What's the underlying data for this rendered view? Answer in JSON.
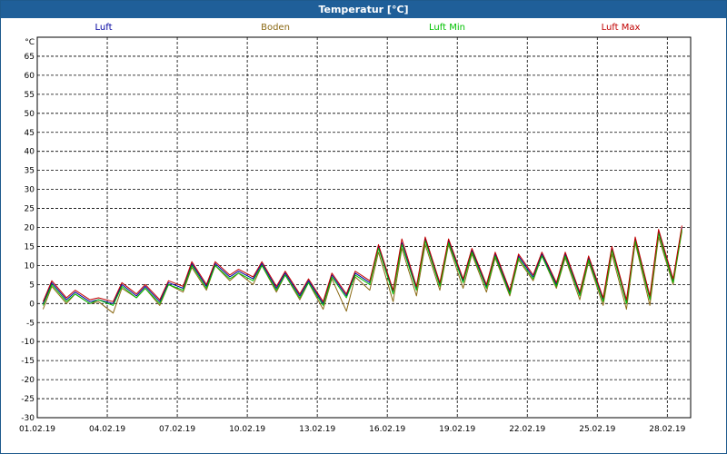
{
  "window": {
    "title": "Temperatur [°C]",
    "title_bar_color": "#1f5f99"
  },
  "chart_data": {
    "type": "line",
    "title": "Temperatur [°C]",
    "ylabel": "°C",
    "xlabel": "",
    "ylim": [
      -30,
      70
    ],
    "yticks": [
      -30,
      -25,
      -20,
      -15,
      -10,
      -5,
      0,
      5,
      10,
      15,
      20,
      25,
      30,
      35,
      40,
      45,
      50,
      55,
      60,
      65
    ],
    "xlim": [
      "01.02.19",
      "01.03.19"
    ],
    "xtick_labels": [
      "01.02.19",
      "04.02.19",
      "07.02.19",
      "10.02.19",
      "13.02.19",
      "16.02.19",
      "19.02.19",
      "22.02.19",
      "25.02.19",
      "28.02.19"
    ],
    "grid": true,
    "legend": "top",
    "x": [
      "01.02.19",
      "02.02.19",
      "03.02.19",
      "04.02.19",
      "05.02.19",
      "06.02.19",
      "07.02.19",
      "08.02.19",
      "09.02.19",
      "10.02.19",
      "11.02.19",
      "12.02.19",
      "13.02.19",
      "14.02.19",
      "15.02.19",
      "16.02.19",
      "17.02.19",
      "18.02.19",
      "19.02.19",
      "20.02.19",
      "21.02.19",
      "22.02.19",
      "23.02.19",
      "24.02.19",
      "25.02.19",
      "26.02.19",
      "27.02.19",
      "28.02.19"
    ],
    "series": [
      {
        "name": "Luft",
        "color": "#0000a0",
        "min": [
          0,
          1,
          0.5,
          0,
          2,
          0.5,
          4,
          4.5,
          7,
          6.5,
          4,
          2,
          0,
          2,
          5.5,
          3,
          4,
          5,
          6,
          4.5,
          3,
          7,
          5,
          2.5,
          1,
          0.5,
          1.5,
          6
        ],
        "max": [
          5.5,
          3,
          1,
          5,
          4.5,
          5.5,
          10.5,
          10.5,
          8.5,
          10.5,
          8,
          6,
          7.5,
          8,
          15,
          16,
          17,
          16.5,
          14,
          13,
          12.5,
          13,
          13,
          12,
          14.5,
          17,
          19,
          20
        ]
      },
      {
        "name": "Boden",
        "color": "#8b6914",
        "min": [
          -1.5,
          0,
          0,
          -2.5,
          1.5,
          -0.5,
          3,
          3.5,
          6,
          5,
          3,
          1,
          -1.5,
          -2,
          3.5,
          0.5,
          2,
          3.5,
          4,
          3,
          2,
          6,
          4,
          1,
          -0.5,
          -1.5,
          -0.5,
          5
        ],
        "max": [
          4.5,
          2.5,
          0.5,
          4,
          4,
          5,
          9.5,
          10,
          8,
          10,
          7.5,
          5.5,
          6.5,
          7,
          13.5,
          14.5,
          15.5,
          15.5,
          13,
          12,
          11.5,
          12.5,
          12,
          11,
          13,
          16,
          17.5,
          19
        ]
      },
      {
        "name": "Luft Min",
        "color": "#00c000",
        "min": [
          -0.5,
          0.5,
          0,
          -0.5,
          1.5,
          0,
          3.5,
          4,
          6.5,
          6,
          3.5,
          1.5,
          -0.5,
          1.5,
          5,
          2.5,
          3.5,
          4.5,
          5.5,
          4,
          2.5,
          6.5,
          4.5,
          2,
          0.5,
          0,
          1,
          5.5
        ],
        "max": [
          5,
          2.5,
          1,
          4.5,
          4,
          5,
          10,
          10,
          8,
          10,
          7.5,
          5.5,
          7,
          7.5,
          14.5,
          15.5,
          16.5,
          16,
          13.5,
          12.5,
          12,
          12.5,
          12.5,
          11.5,
          14,
          16.5,
          18.5,
          19.5
        ]
      },
      {
        "name": "Luft Max",
        "color": "#c00000",
        "min": [
          0.5,
          1.5,
          1,
          0.5,
          2.5,
          1,
          4.5,
          5,
          7.5,
          7,
          4.5,
          2.5,
          0.5,
          2.5,
          6,
          3.5,
          4.5,
          5.5,
          6.5,
          5,
          3.5,
          7.5,
          5.5,
          3,
          1.5,
          1,
          2,
          6.5
        ],
        "max": [
          6,
          3.5,
          1.5,
          5.5,
          5,
          6,
          11,
          11,
          9,
          11,
          8.5,
          6.5,
          8,
          8.5,
          15.5,
          17,
          17.5,
          17,
          14.5,
          13.5,
          13,
          13.5,
          13.5,
          12.5,
          15,
          17.5,
          19.5,
          20.5
        ]
      }
    ]
  }
}
